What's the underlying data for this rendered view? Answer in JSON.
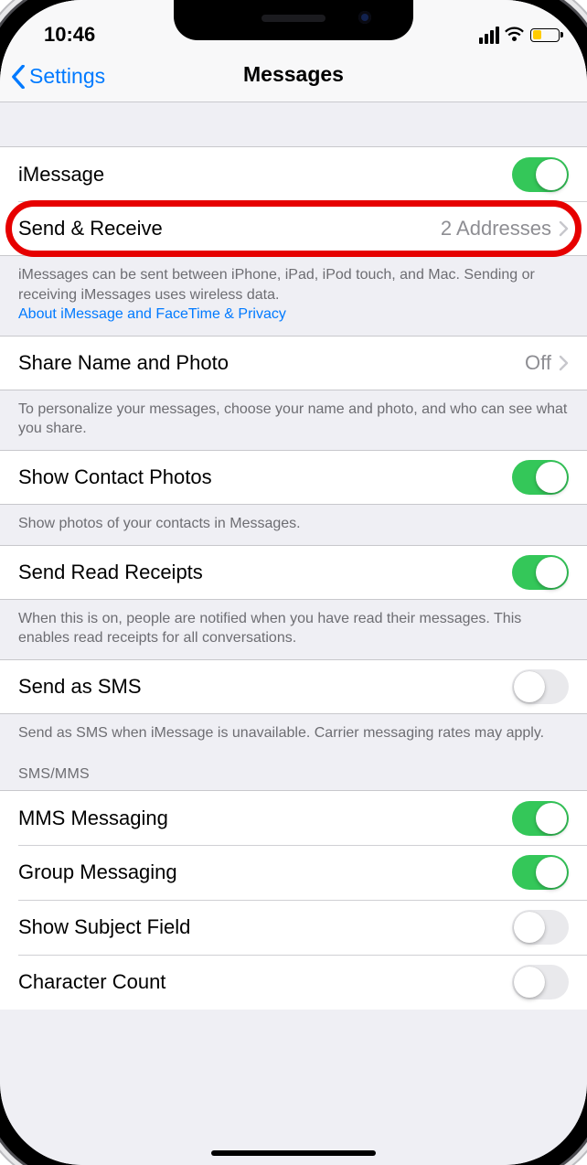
{
  "status": {
    "time": "10:46"
  },
  "nav": {
    "back": "Settings",
    "title": "Messages"
  },
  "rows": {
    "imessage": {
      "label": "iMessage",
      "on": true
    },
    "sendReceive": {
      "label": "Send & Receive",
      "value": "2 Addresses"
    },
    "shareNamePhoto": {
      "label": "Share Name and Photo",
      "value": "Off"
    },
    "showContactPhotos": {
      "label": "Show Contact Photos",
      "on": true
    },
    "readReceipts": {
      "label": "Send Read Receipts",
      "on": true
    },
    "sendAsSMS": {
      "label": "Send as SMS",
      "on": false
    },
    "mms": {
      "label": "MMS Messaging",
      "on": true
    },
    "group": {
      "label": "Group Messaging",
      "on": true
    },
    "subject": {
      "label": "Show Subject Field",
      "on": false
    },
    "charCount": {
      "label": "Character Count",
      "on": false
    }
  },
  "footers": {
    "imessage": "iMessages can be sent between iPhone, iPad, iPod touch, and Mac. Sending or receiving iMessages uses wireless data.",
    "imessageLink": "About iMessage and FaceTime & Privacy",
    "shareNamePhoto": "To personalize your messages, choose your name and photo, and who can see what you share.",
    "showContactPhotos": "Show photos of your contacts in Messages.",
    "readReceipts": "When this is on, people are notified when you have read their messages. This enables read receipts for all conversations.",
    "sendAsSMS": "Send as SMS when iMessage is unavailable. Carrier messaging rates may apply."
  },
  "sections": {
    "smsmms": "SMS/MMS"
  }
}
